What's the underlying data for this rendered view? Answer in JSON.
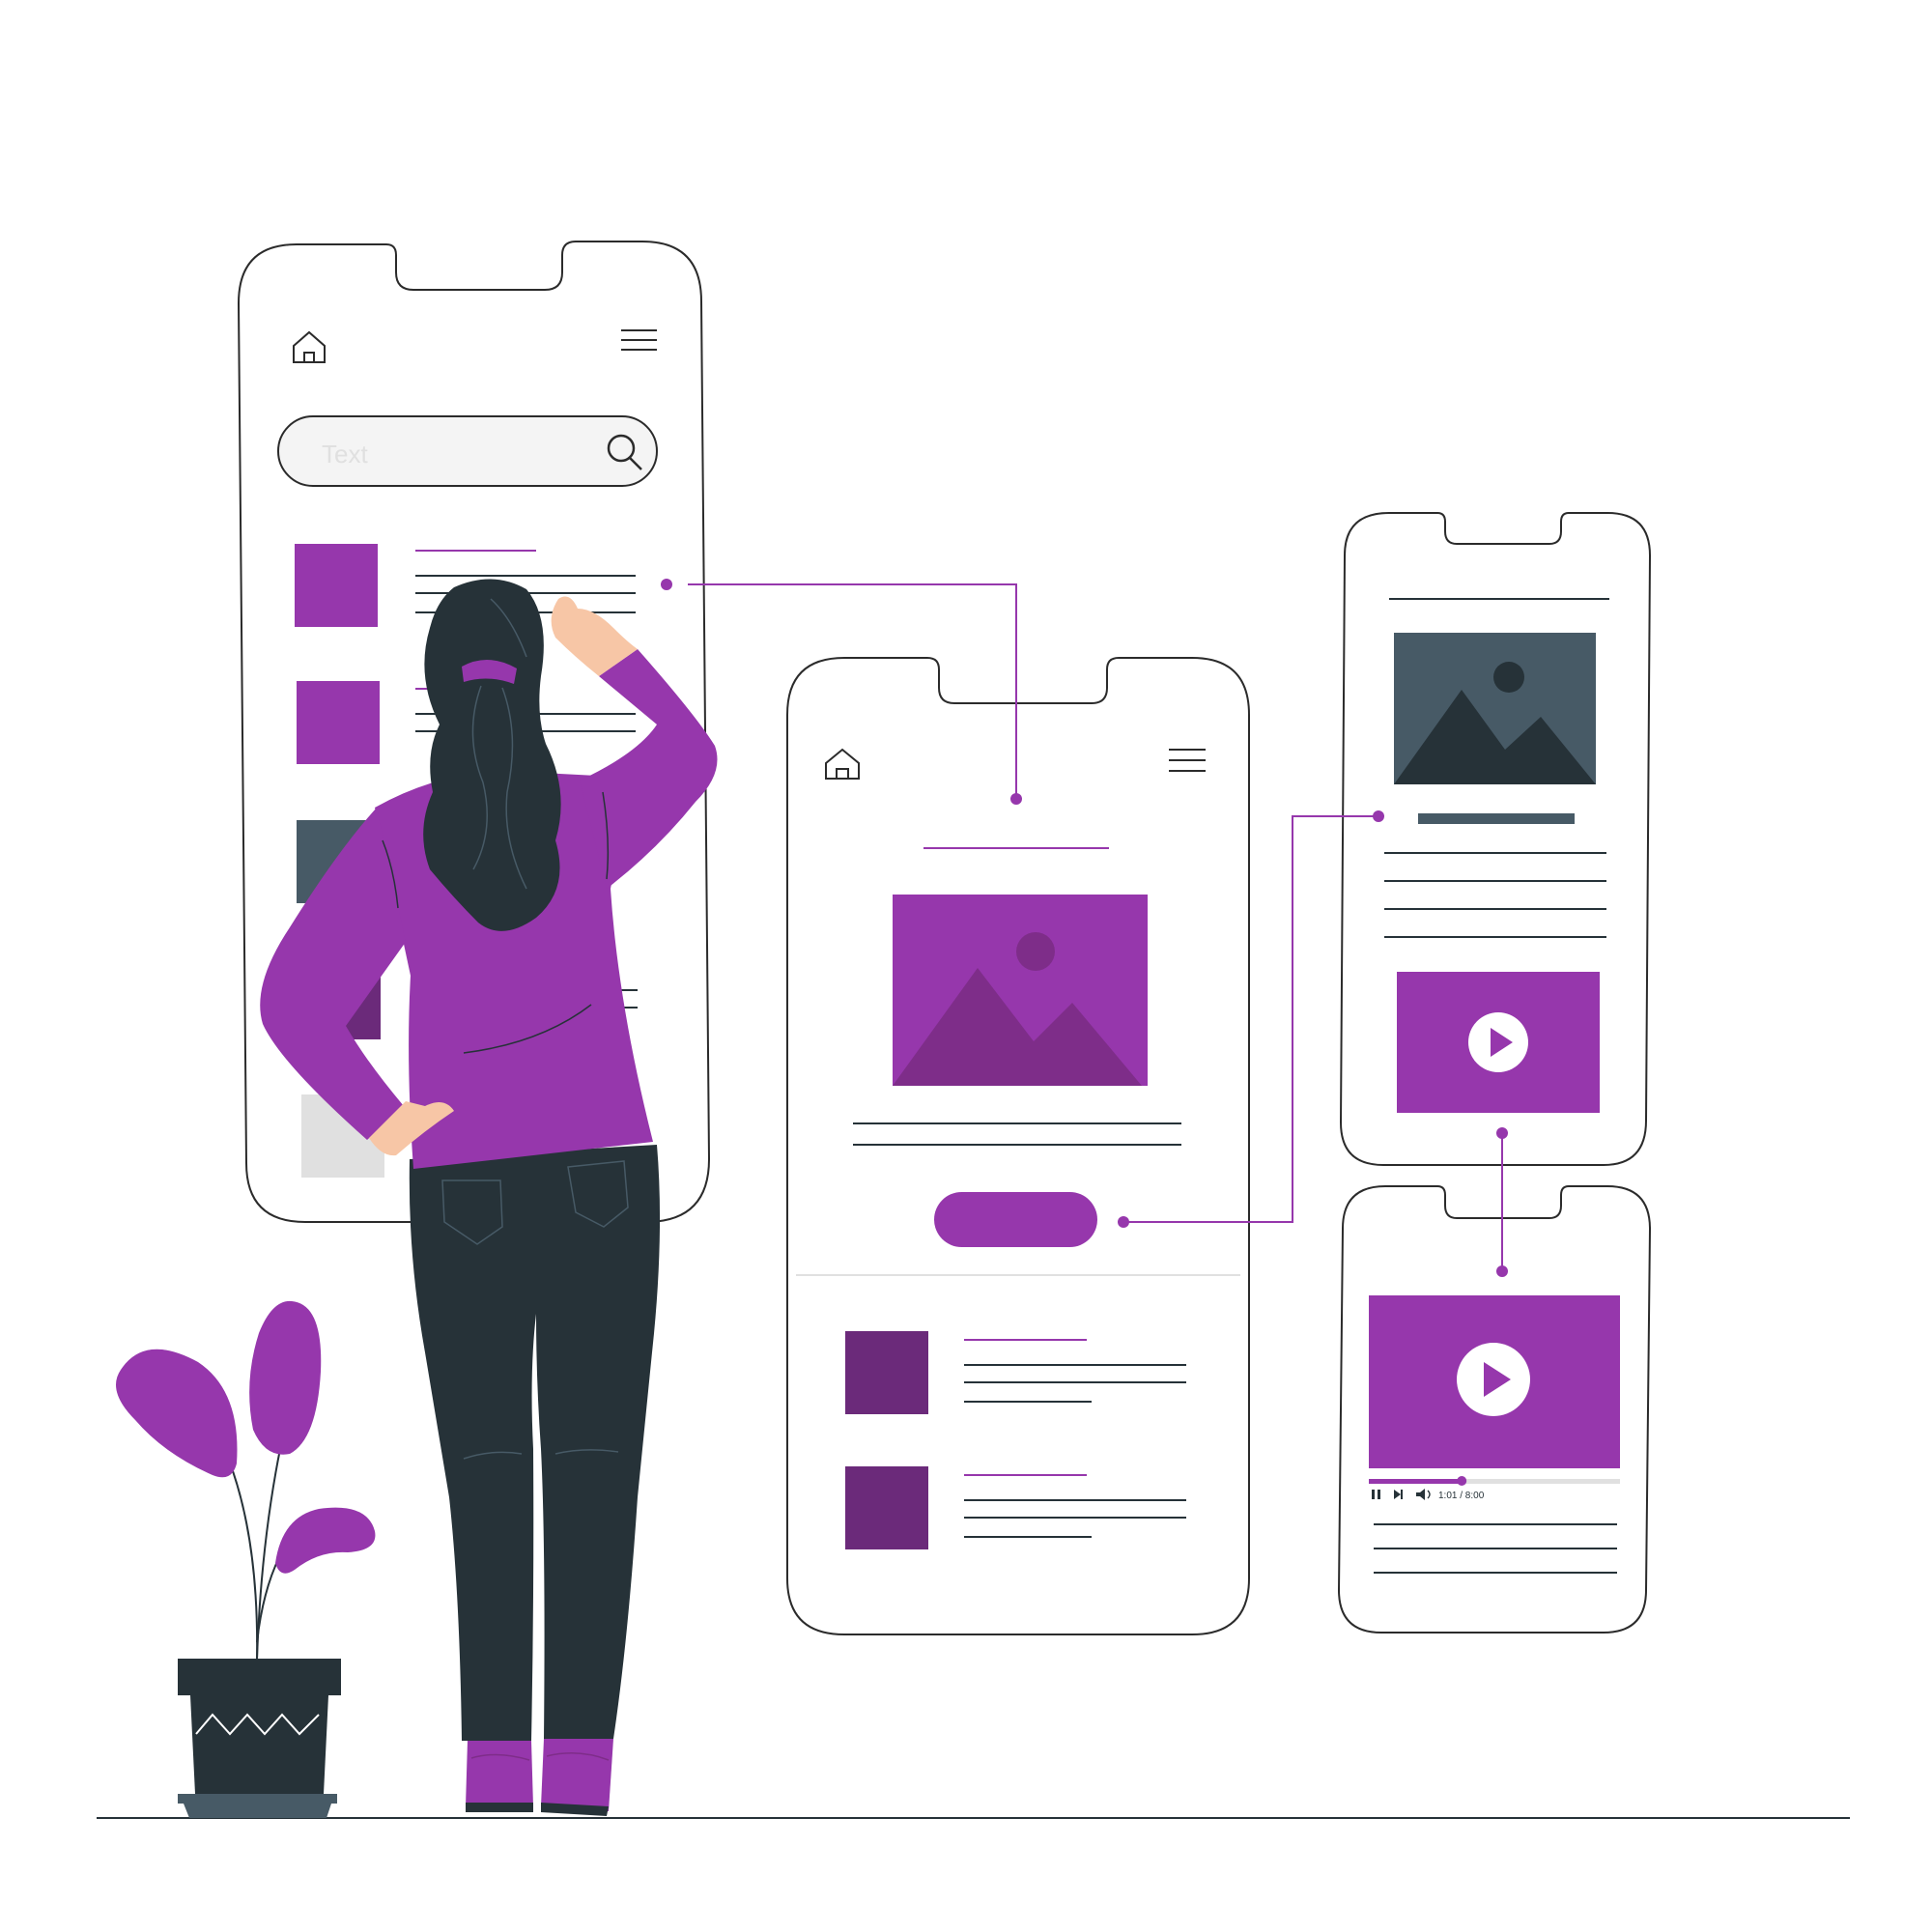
{
  "colors": {
    "accent": "#9637AC",
    "accent_dark": "#6B2A7A",
    "accent_mid": "#7E2D89",
    "slate": "#475A66",
    "charcoal": "#263238",
    "outline": "#2B2B2B",
    "field_bg": "#F4F4F4",
    "skin": "#F7C6A6",
    "placeholder": "#E0E0E0"
  },
  "search": {
    "placeholder": "Text"
  },
  "player": {
    "time": "1:01 / 8:00",
    "progress": 0.37
  },
  "icons": [
    "home-icon",
    "menu-icon",
    "search-icon",
    "image-icon",
    "play-icon",
    "pause-icon",
    "next-icon",
    "volume-icon"
  ]
}
